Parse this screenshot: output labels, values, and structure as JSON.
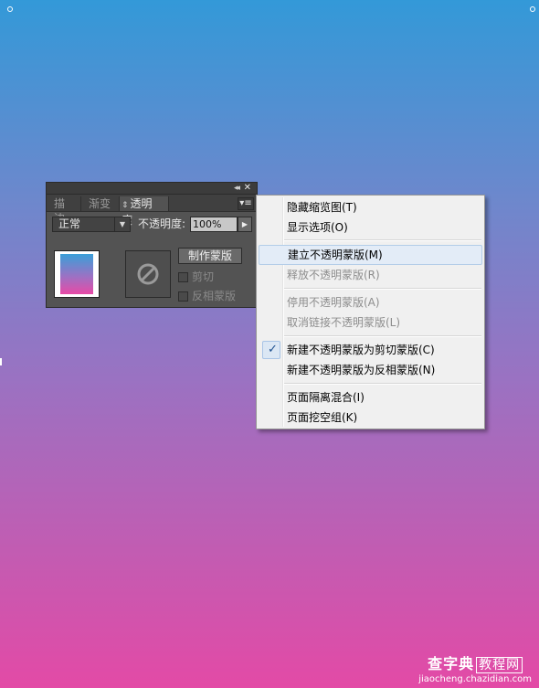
{
  "panel": {
    "collapse_icon": "collapse-icon",
    "close_icon": "close-icon",
    "tabs": [
      {
        "label": "描边"
      },
      {
        "label": "渐变"
      },
      {
        "label": "透明度",
        "active": true
      }
    ],
    "blend_mode": "正常",
    "opacity_label": "不透明度:",
    "opacity_value": "100%",
    "make_mask_button": "制作蒙版",
    "clip_label": "剪切",
    "invert_label": "反相蒙版"
  },
  "menu": {
    "items": [
      {
        "label": "隐藏缩览图(T)",
        "enabled": true
      },
      {
        "label": "显示选项(O)",
        "enabled": true
      },
      {
        "label": "建立不透明蒙版(M)",
        "enabled": true,
        "highlighted": true
      },
      {
        "label": "释放不透明蒙版(R)",
        "enabled": false
      },
      {
        "label": "停用不透明蒙版(A)",
        "enabled": false
      },
      {
        "label": "取消链接不透明蒙版(L)",
        "enabled": false
      },
      {
        "label": "新建不透明蒙版为剪切蒙版(C)",
        "enabled": true,
        "checked": true
      },
      {
        "label": "新建不透明蒙版为反相蒙版(N)",
        "enabled": true
      },
      {
        "label": "页面隔离混合(I)",
        "enabled": true
      },
      {
        "label": "页面挖空组(K)",
        "enabled": true
      }
    ]
  },
  "watermark": {
    "brand": "查字典",
    "tag": "教程网",
    "url": "jiaocheng.chazidian.com"
  },
  "colors": {
    "gradient_top": "#3399d8",
    "gradient_bottom": "#e34aa6",
    "panel_bg": "#535353",
    "menu_bg": "#f0f0f0",
    "highlight": "#e3ecf7"
  }
}
